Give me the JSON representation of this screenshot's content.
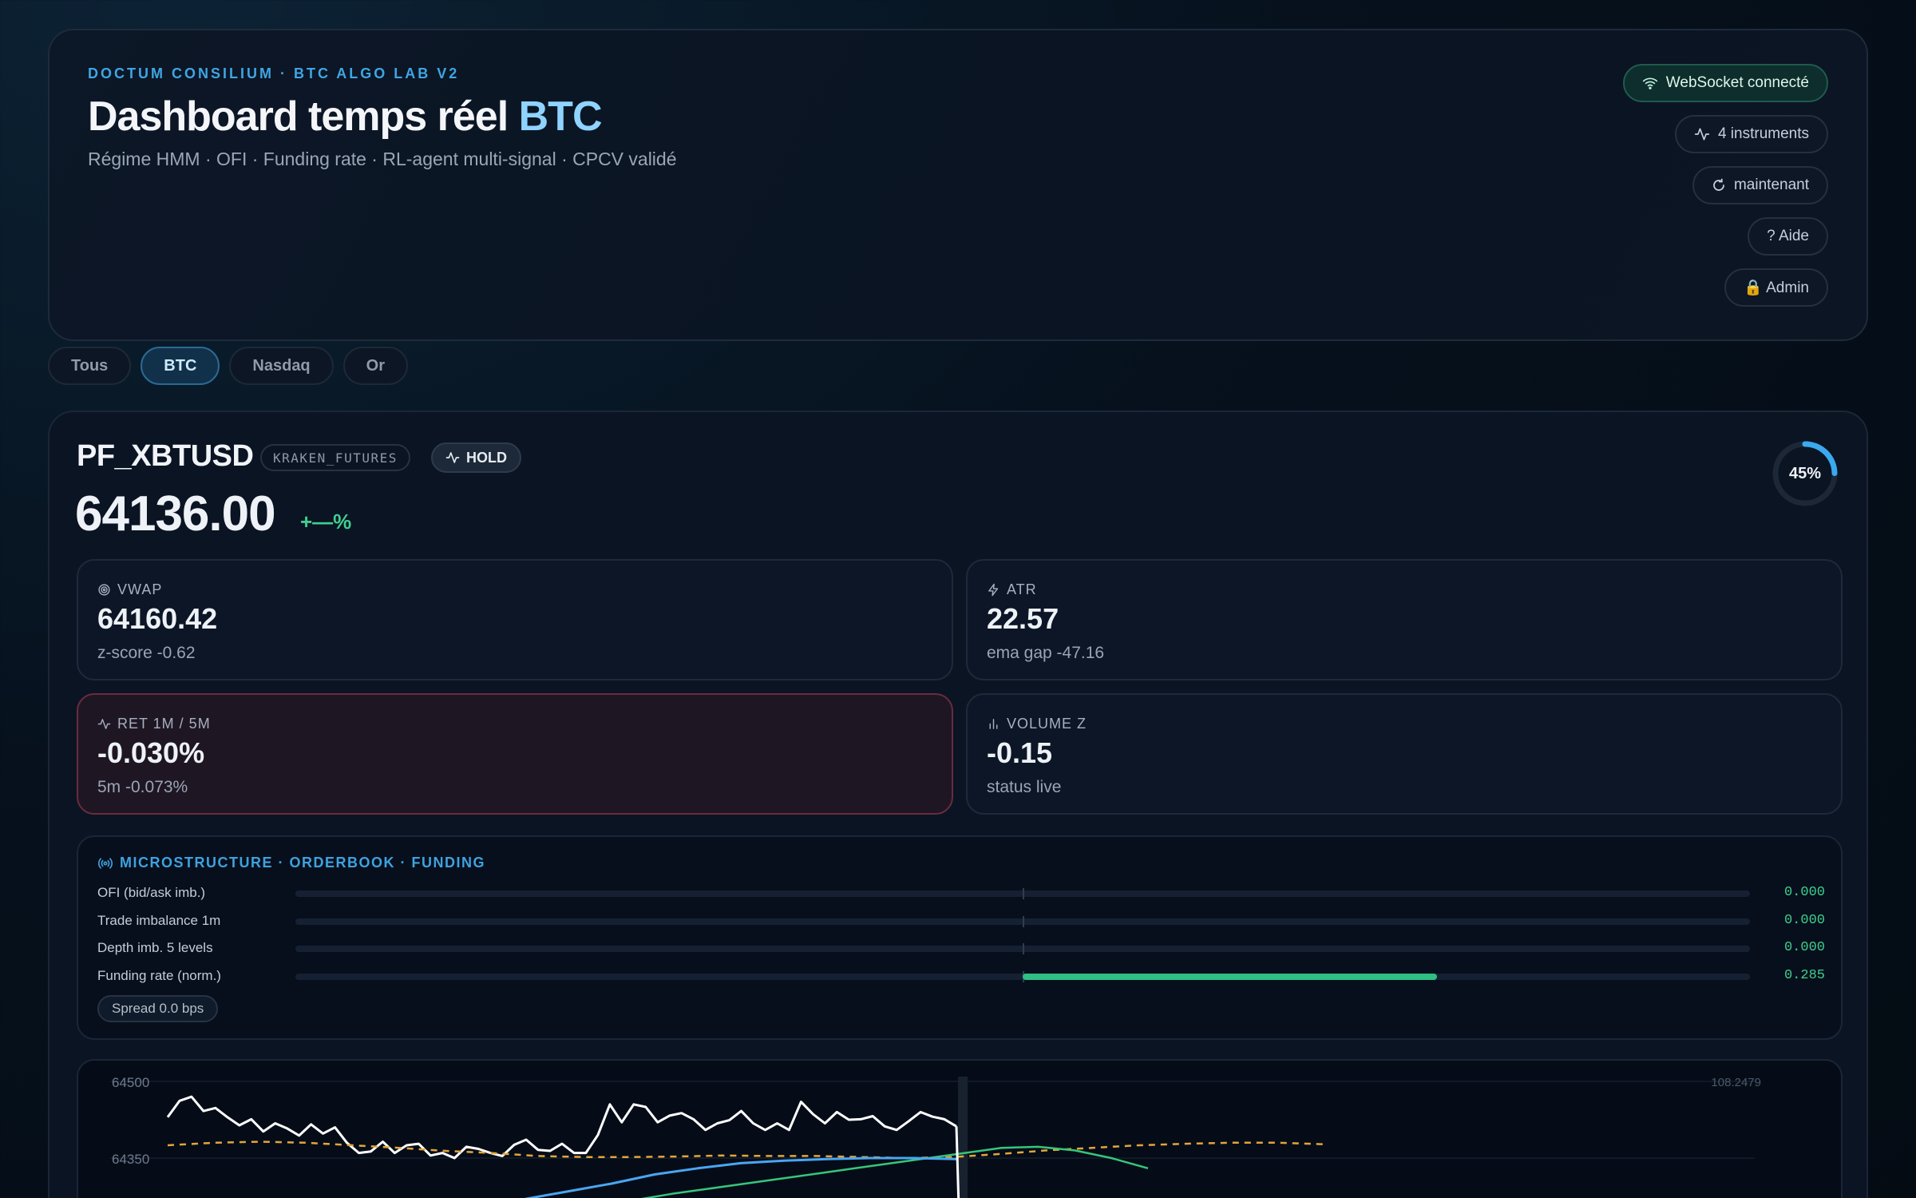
{
  "header": {
    "eyebrow": "DOCTUM CONSILIUM · BTC ALGO LAB V2",
    "title_main": "Dashboard temps réel ",
    "title_accent": "BTC",
    "subtitle": "Régime HMM · OFI · Funding rate · RL-agent multi-signal · CPCV validé",
    "pills": {
      "websocket": "WebSocket connecté",
      "instruments": "4 instruments",
      "updated": "maintenant",
      "help": "? Aide",
      "admin": "🔒 Admin"
    }
  },
  "tabs": [
    {
      "label": "Tous",
      "active": false
    },
    {
      "label": "BTC",
      "active": true
    },
    {
      "label": "Nasdaq",
      "active": false
    },
    {
      "label": "Or",
      "active": false
    }
  ],
  "instrument": {
    "symbol": "PF_XBTUSD",
    "exchange": "KRAKEN_FUTURES",
    "signal": "HOLD",
    "price": "64136.00",
    "change": "+—%",
    "confidence": {
      "label": "45%",
      "fraction": 0.45
    }
  },
  "metrics": {
    "vwap": {
      "label": "VWAP",
      "value": "64160.42",
      "sub": "z-score -0.62"
    },
    "atr": {
      "label": "ATR",
      "value": "22.57",
      "sub": "ema gap -47.16"
    },
    "ret": {
      "label": "RET 1M / 5M",
      "value": "-0.030%",
      "sub": "5m -0.073%"
    },
    "volz": {
      "label": "VOLUME Z",
      "value": "-0.15",
      "sub": "status live"
    }
  },
  "microstructure": {
    "title": "MICROSTRUCTURE · ORDERBOOK · FUNDING",
    "rows": [
      {
        "label": "OFI (bid/ask imb.)",
        "value": "0.000",
        "level": 0.0
      },
      {
        "label": "Trade imbalance 1m",
        "value": "0.000",
        "level": 0.0
      },
      {
        "label": "Depth imb. 5 levels",
        "value": "0.000",
        "level": 0.0
      },
      {
        "label": "Funding rate (norm.)",
        "value": "0.285",
        "level": 0.285
      }
    ],
    "spread": "Spread 0.0 bps"
  },
  "chart_data": {
    "type": "line",
    "y_ticks_left": [
      "64500",
      "64350"
    ],
    "y_label_right": "108.2479",
    "ylim": [
      64200,
      64500
    ],
    "series": [
      {
        "style": "white",
        "values": [
          64430,
          64462,
          64470,
          64442,
          64448,
          64430,
          64414,
          64426,
          64402,
          64418,
          64408,
          64394,
          64416,
          64398,
          64410,
          64380,
          64360,
          64363,
          64382,
          64360,
          64375,
          64378,
          64355,
          64360,
          64350,
          64372,
          64368,
          64360,
          64354,
          64376,
          64386,
          64366,
          64364,
          64378,
          64360,
          64360,
          64395,
          64455,
          64420,
          64455,
          64450,
          64420,
          64433,
          64438,
          64426,
          64405,
          64418,
          64424,
          64442,
          64418,
          64405,
          64418,
          64405,
          64460,
          64436,
          64418,
          64440,
          64425,
          64426,
          64432,
          64412,
          64405,
          64422,
          64440,
          64431,
          64426,
          64412
        ]
      },
      {
        "style": "orange-dashed",
        "values": [
          64375,
          64380,
          64382,
          64380,
          64375,
          64370,
          64364,
          64360,
          64354,
          64352,
          64352,
          64353,
          64355,
          64354,
          64354,
          64352,
          64350,
          64352,
          64358,
          64365,
          64370,
          64375,
          64378,
          64380,
          64380,
          64377
        ]
      },
      {
        "style": "green",
        "values": [
          64212,
          64230,
          64250,
          64268,
          64280,
          64290,
          64300,
          64310,
          64320,
          64330,
          64340,
          64350,
          64360,
          64370,
          64372,
          64365,
          64350,
          64330
        ]
      },
      {
        "style": "blue",
        "values": [
          64270,
          64285,
          64300,
          64318,
          64330,
          64340,
          64345,
          64348,
          64350,
          64350,
          64348
        ]
      }
    ]
  },
  "colors": {
    "accent": "#3fa6e3",
    "positive": "#3fcf8e",
    "negative_card_border": "#6a2c3c"
  }
}
